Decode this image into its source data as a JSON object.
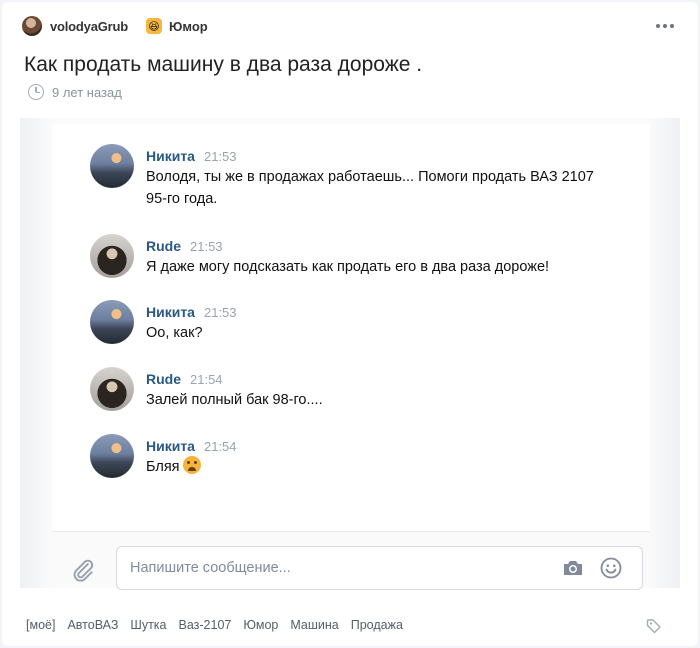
{
  "post": {
    "author": "volodyaGrub",
    "category": "Юмор",
    "category_icon": "laughing-emoji-icon",
    "title": "Как продать машину в два раза дороже .",
    "time_ago": "9 лет назад"
  },
  "chat": {
    "messages": [
      {
        "name": "Никита",
        "time": "21:53",
        "text": "Володя, ты же в продажах работаешь... Помоги продать ВАЗ 2107 95-го года."
      },
      {
        "name": "Rude",
        "time": "21:53",
        "text": "Я даже могу подсказать как продать его в два раза дороже!"
      },
      {
        "name": "Никита",
        "time": "21:53",
        "text": "Оо, как?"
      },
      {
        "name": "Rude",
        "time": "21:54",
        "text": "Залей полный бак 98-го...."
      },
      {
        "name": "Никита",
        "time": "21:54",
        "text": "Бляя"
      }
    ],
    "composer_placeholder": "Напишите сообщение..."
  },
  "tags": [
    "[моё]",
    "АвтоВАЗ",
    "Шутка",
    "Ваз-2107",
    "Юмор",
    "Машина",
    "Продажа"
  ],
  "colors": {
    "name_link": "#2a5885",
    "category_badge": "#f6b73c"
  }
}
